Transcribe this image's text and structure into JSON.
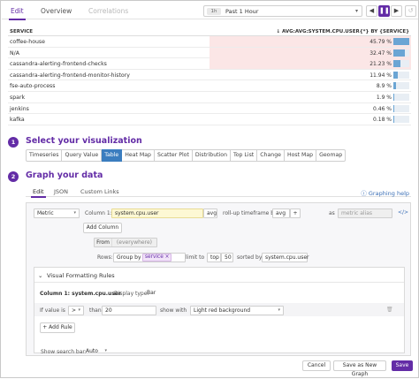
{
  "tabs": {
    "edit": "Edit",
    "overview": "Overview",
    "correlations": "Correlations"
  },
  "time": {
    "chip": "1h",
    "label": "Past 1 Hour"
  },
  "controls": {
    "prev": "◀",
    "pause": "❚❚",
    "next": "▶",
    "reset": "↺",
    "fullscreen": "⤢"
  },
  "table": {
    "col_service": "SERVICE",
    "col_value": "↓ AVG:AVG:SYSTEM.CPU.USER{*} BY {SERVICE}",
    "rows": [
      {
        "name": "coffee-house",
        "pct": "45.79 %",
        "fraction": 0.4579
      },
      {
        "name": "N/A",
        "pct": "32.47 %",
        "fraction": 0.3247
      },
      {
        "name": "cassandra-alerting-frontend-checks",
        "pct": "21.23 %",
        "fraction": 0.2123
      },
      {
        "name": "cassandra-alerting-frontend-monitor-history",
        "pct": "11.94 %",
        "fraction": 0.1194
      },
      {
        "name": "fse-auto-process",
        "pct": "8.9 %",
        "fraction": 0.089
      },
      {
        "name": "spark",
        "pct": "1.9 %",
        "fraction": 0.019
      },
      {
        "name": "jenkins",
        "pct": "0.46 %",
        "fraction": 0.0046
      },
      {
        "name": "kafka",
        "pct": "0.18 %",
        "fraction": 0.0018
      }
    ],
    "highlight_color": "#fbe6e6",
    "bar_color": "#6aa5d4"
  },
  "step1": {
    "num": "1",
    "title": "Select your visualization"
  },
  "viz": [
    "Timeseries",
    "Query Value",
    "Table",
    "Heat Map",
    "Scatter Plot",
    "Distribution",
    "Top List",
    "Change",
    "Host Map",
    "Geomap"
  ],
  "step2": {
    "num": "2",
    "title": "Graph your data"
  },
  "graph_tabs": {
    "edit": "Edit",
    "json": "JSON",
    "custom": "Custom Links",
    "help": "Graphing help"
  },
  "query": {
    "type": "Metric",
    "col_label": "Column 1:",
    "metric": "system.cpu.user",
    "agg": "avg",
    "rollup": "roll-up timeframe by",
    "rollup_agg": "avg",
    "plus": "+",
    "as": "as",
    "alias_placeholder": "metric alias",
    "add_column": "Add Column",
    "from_label": "From",
    "from_value": "(everywhere)",
    "rows_label": "Rows:",
    "group_by": "Group by",
    "group_tag": "service",
    "limit_to": "limit to",
    "top": "top",
    "limit": "50",
    "sorted_by": "sorted by",
    "sort_metric": "system.cpu.user"
  },
  "vfr": {
    "title": "Visual Formatting Rules",
    "column": "Column 1: system.cpu.user",
    "display_type_label": "Display type:",
    "display_type": "Bar",
    "if_value": "If value is",
    "comparator": ">",
    "than": "than",
    "threshold": "20",
    "show_with": "show with",
    "format": "Light red background",
    "add_rule": "+ Add Rule"
  },
  "search_bar": {
    "label": "Show search bar:",
    "value": "Auto"
  },
  "footer": {
    "cancel": "Cancel",
    "save_new": "Save as New Graph",
    "save": "Save"
  }
}
